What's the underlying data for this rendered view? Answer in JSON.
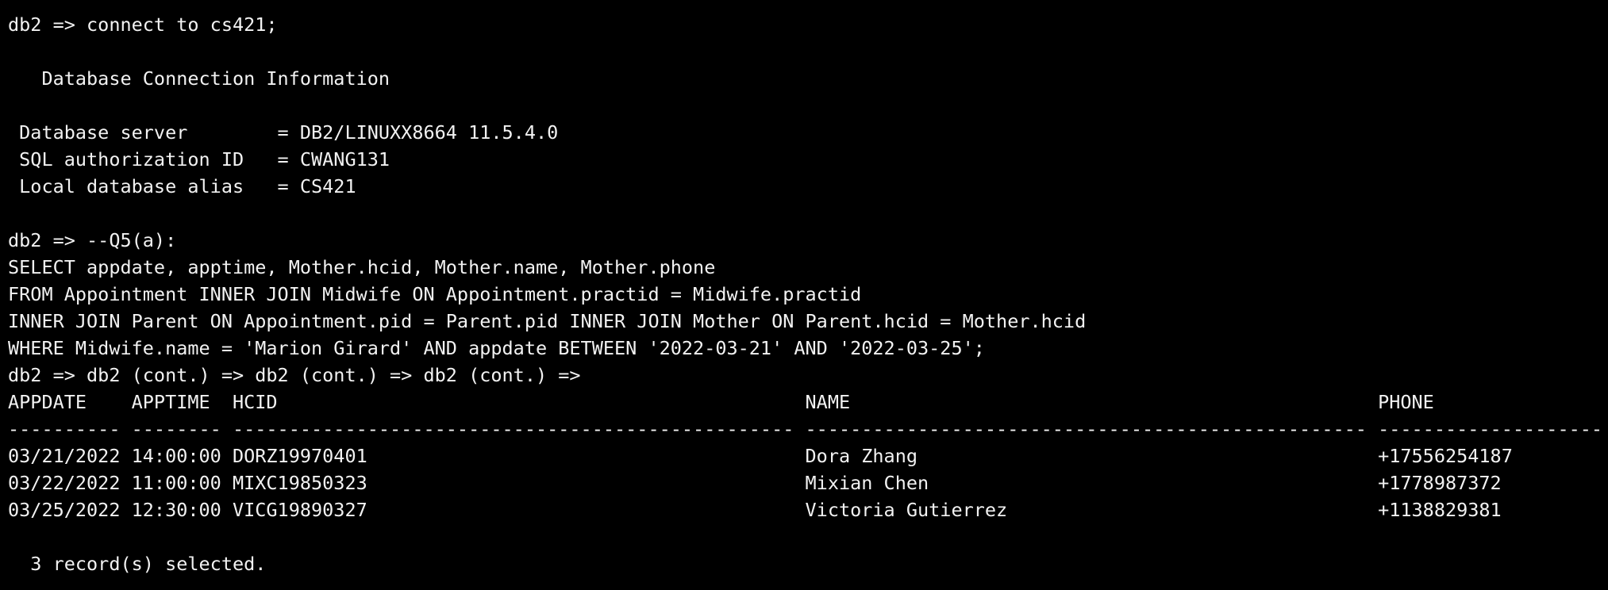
{
  "terminal": {
    "colors": {
      "background": "#000000",
      "foreground": "#f2f2f2"
    },
    "lines": [
      "db2 => connect to cs421;",
      "",
      "   Database Connection Information",
      "",
      " Database server        = DB2/LINUXX8664 11.5.4.0",
      " SQL authorization ID   = CWANG131",
      " Local database alias   = CS421",
      "",
      "db2 => --Q5(a):",
      "SELECT appdate, apptime, Mother.hcid, Mother.name, Mother.phone",
      "FROM Appointment INNER JOIN Midwife ON Appointment.practid = Midwife.practid",
      "INNER JOIN Parent ON Appointment.pid = Parent.pid INNER JOIN Mother ON Parent.hcid = Mother.hcid",
      "WHERE Midwife.name = 'Marion Girard' AND appdate BETWEEN '2022-03-21' AND '2022-03-25';",
      "db2 => db2 (cont.) => db2 (cont.) => db2 (cont.) =>",
      "APPDATE    APPTIME  HCID                                               NAME                                               PHONE",
      "---------- -------- -------------------------------------------------- -------------------------------------------------- --------------------",
      "03/21/2022 14:00:00 DORZ19970401                                       Dora Zhang                                         +17556254187",
      "03/22/2022 11:00:00 MIXC19850323                                       Mixian Chen                                        +1778987372",
      "03/25/2022 12:30:00 VICG19890327                                       Victoria Gutierrez                                 +1138829381",
      "",
      "  3 record(s) selected."
    ]
  }
}
